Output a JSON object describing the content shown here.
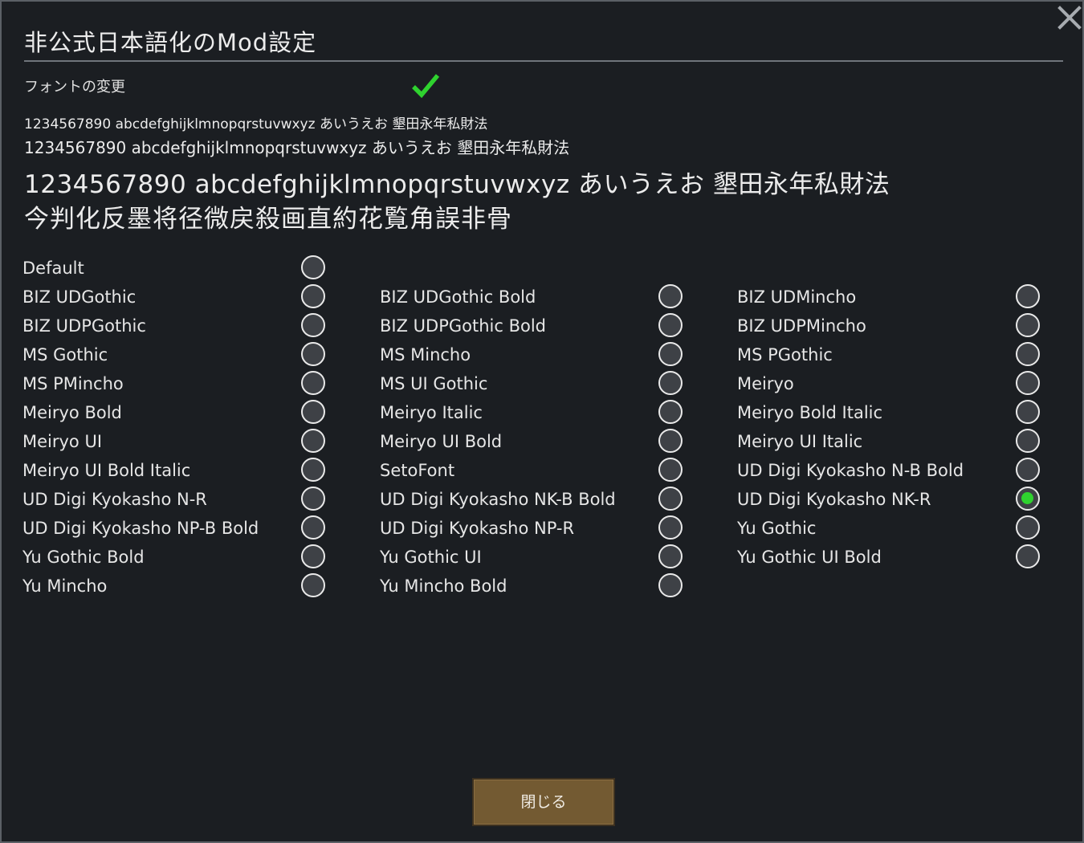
{
  "dialog": {
    "title": "非公式日本語化のMod設定",
    "close_icon": "close-x-icon",
    "font_change": {
      "label": "フォントの変更",
      "enabled": true,
      "check_icon": "checkmark-icon",
      "check_color": "#2fd22f"
    },
    "samples": {
      "small": "1234567890 abcdefghijklmnopqrstuvwxyz あいうえお 墾田永年私財法",
      "medium": "1234567890 abcdefghijklmnopqrstuvwxyz あいうえお 墾田永年私財法",
      "large_line1": "1234567890 abcdefghijklmnopqrstuvwxyz あいうえお 墾田永年私財法",
      "large_line2": "今判化反墨将径微戻殺画直約花覧角誤非骨"
    },
    "font_options": [
      {
        "label": "Default",
        "selected": false
      },
      {
        "label": "BIZ UDGothic",
        "selected": false
      },
      {
        "label": "BIZ UDGothic Bold",
        "selected": false
      },
      {
        "label": "BIZ UDMincho",
        "selected": false
      },
      {
        "label": "BIZ UDPGothic",
        "selected": false
      },
      {
        "label": "BIZ UDPGothic Bold",
        "selected": false
      },
      {
        "label": "BIZ UDPMincho",
        "selected": false
      },
      {
        "label": "MS Gothic",
        "selected": false
      },
      {
        "label": "MS Mincho",
        "selected": false
      },
      {
        "label": "MS PGothic",
        "selected": false
      },
      {
        "label": "MS PMincho",
        "selected": false
      },
      {
        "label": "MS UI Gothic",
        "selected": false
      },
      {
        "label": "Meiryo",
        "selected": false
      },
      {
        "label": "Meiryo Bold",
        "selected": false
      },
      {
        "label": "Meiryo Italic",
        "selected": false
      },
      {
        "label": "Meiryo Bold Italic",
        "selected": false
      },
      {
        "label": "Meiryo UI",
        "selected": false
      },
      {
        "label": "Meiryo UI Bold",
        "selected": false
      },
      {
        "label": "Meiryo UI Italic",
        "selected": false
      },
      {
        "label": "Meiryo UI Bold Italic",
        "selected": false
      },
      {
        "label": "SetoFont",
        "selected": false
      },
      {
        "label": "UD Digi Kyokasho N-B Bold",
        "selected": false
      },
      {
        "label": "UD Digi Kyokasho N-R",
        "selected": false
      },
      {
        "label": "UD Digi Kyokasho NK-B Bold",
        "selected": false
      },
      {
        "label": "UD Digi Kyokasho NK-R",
        "selected": true
      },
      {
        "label": "UD Digi Kyokasho NP-B Bold",
        "selected": false
      },
      {
        "label": "UD Digi Kyokasho NP-R",
        "selected": false
      },
      {
        "label": "Yu Gothic",
        "selected": false
      },
      {
        "label": "Yu Gothic Bold",
        "selected": false
      },
      {
        "label": "Yu Gothic UI",
        "selected": false
      },
      {
        "label": "Yu Gothic UI Bold",
        "selected": false
      },
      {
        "label": "Yu Mincho",
        "selected": false
      },
      {
        "label": "Yu Mincho Bold",
        "selected": false
      }
    ],
    "close_button_label": "閉じる",
    "colors": {
      "background": "#1b1e22",
      "selected_radio": "#2fd22f",
      "button": "#735a32"
    }
  }
}
